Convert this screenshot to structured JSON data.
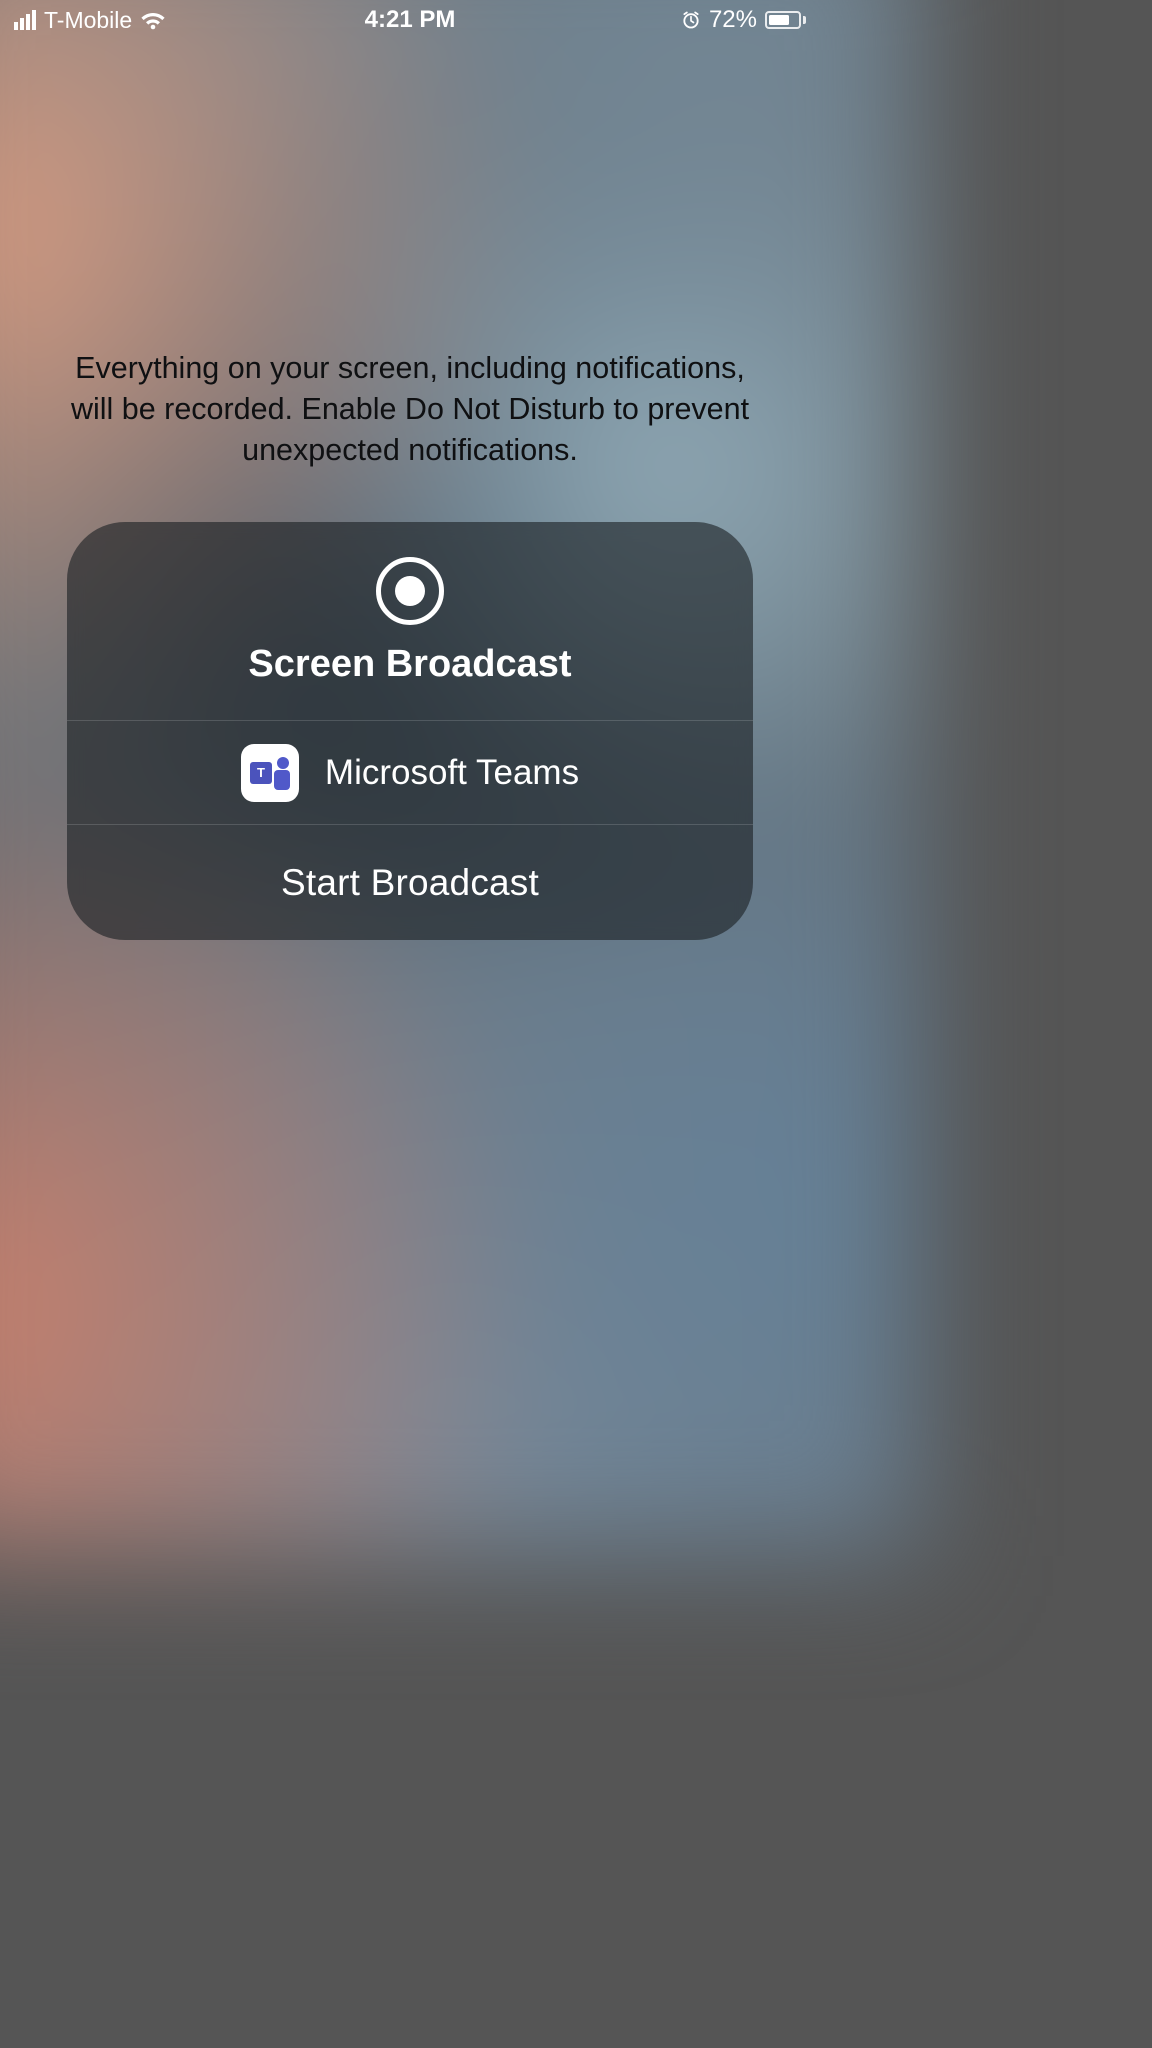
{
  "status": {
    "carrier": "T-Mobile",
    "time": "4:21 PM",
    "battery_pct": "72%",
    "battery_fill_pct": 72
  },
  "info_text": "Everything on your screen, including notifications, will be recorded. Enable Do Not Disturb to prevent unexpected notifications.",
  "card": {
    "title": "Screen Broadcast",
    "app": {
      "name": "Microsoft Teams",
      "glyph_letter": "T"
    },
    "action_label": "Start Broadcast"
  }
}
